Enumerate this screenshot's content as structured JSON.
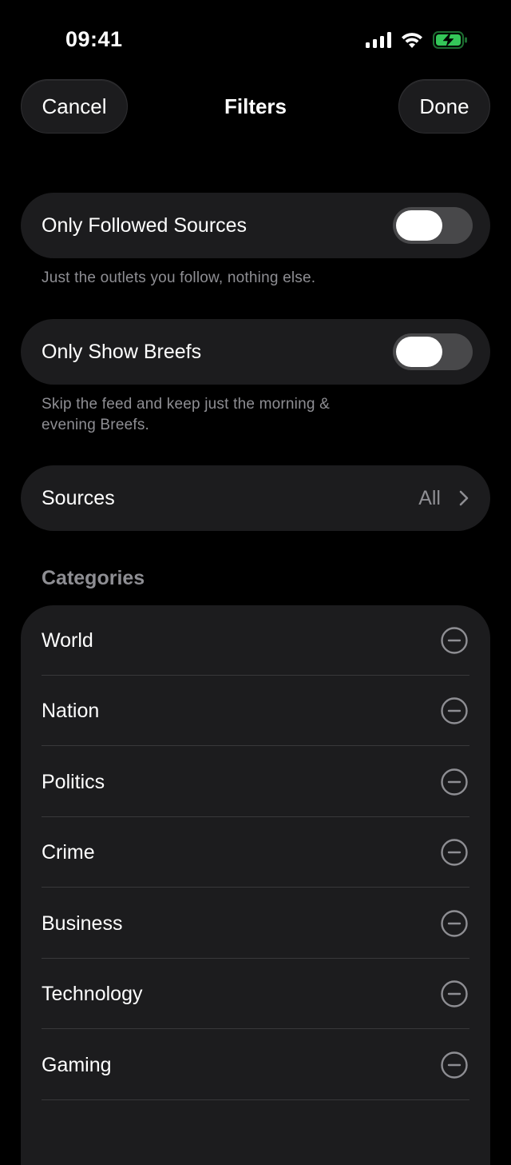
{
  "status_bar": {
    "time": "09:41",
    "icons": [
      "signal-icon",
      "wifi-icon",
      "battery-charging-icon"
    ],
    "battery_color": "#34c759"
  },
  "nav": {
    "cancel_label": "Cancel",
    "title": "Filters",
    "done_label": "Done"
  },
  "settings": {
    "followed_sources": {
      "label": "Only Followed Sources",
      "enabled": false,
      "footnote": "Just the outlets you follow, nothing else."
    },
    "breefs": {
      "label": "Only Show Breefs",
      "enabled": false,
      "footnote": "Skip the feed and keep just the morning & evening Breefs."
    },
    "sources": {
      "label": "Sources",
      "value": "All"
    }
  },
  "categories": {
    "header": "Categories",
    "items": [
      {
        "label": "World",
        "icon": "minus-circle-icon"
      },
      {
        "label": "Nation",
        "icon": "minus-circle-icon"
      },
      {
        "label": "Politics",
        "icon": "minus-circle-icon"
      },
      {
        "label": "Crime",
        "icon": "minus-circle-icon"
      },
      {
        "label": "Business",
        "icon": "minus-circle-icon"
      },
      {
        "label": "Technology",
        "icon": "minus-circle-icon"
      },
      {
        "label": "Gaming",
        "icon": "minus-circle-icon"
      }
    ]
  },
  "colors": {
    "background": "#000000",
    "card": "#1c1c1e",
    "secondary_text": "#8e8e93",
    "toggle_off": "#48484a"
  }
}
